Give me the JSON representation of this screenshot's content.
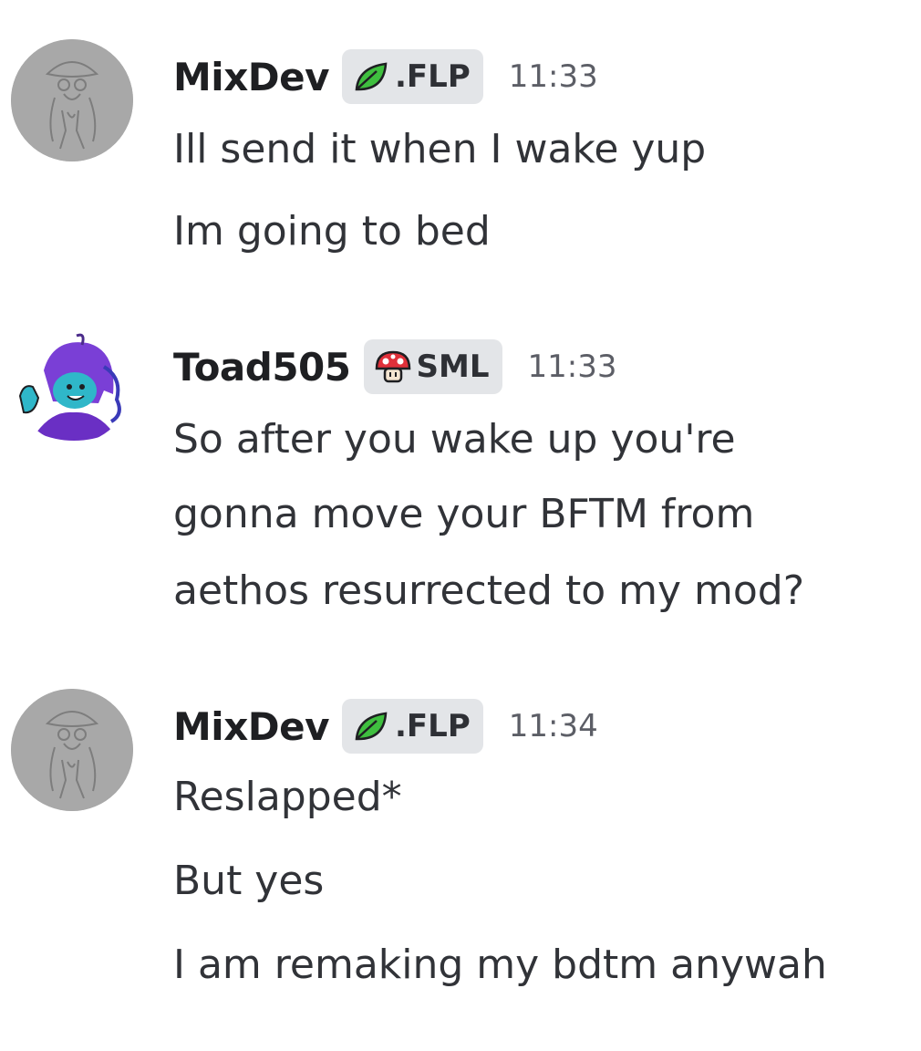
{
  "messages": [
    {
      "username": "MixDev",
      "tag": ".FLP",
      "tag_icon": "leaf-icon",
      "timestamp": "11:33",
      "lines": [
        "Ill send it when I wake yup",
        "Im going to bed"
      ]
    },
    {
      "username": "Toad505",
      "tag": "SML",
      "tag_icon": "mushroom-icon",
      "timestamp": "11:33",
      "lines": [
        "So after you wake up you're",
        "gonna move your BFTM from",
        "aethos resurrected to my mod?"
      ]
    },
    {
      "username": "MixDev",
      "tag": ".FLP",
      "tag_icon": "leaf-icon",
      "timestamp": "11:34",
      "lines": [
        "Reslapped*",
        "But yes",
        "I am remaking my bdtm anywah"
      ]
    }
  ],
  "colors": {
    "username": "#1e1f22",
    "text": "#313338",
    "timestamp": "#5c5e66",
    "tag_bg": "#e3e5e8",
    "leaf": "#3fbf3f",
    "mushroom": "#e0303a",
    "toad_hair": "#7a3fd6",
    "toad_skin": "#2fb7c9"
  }
}
